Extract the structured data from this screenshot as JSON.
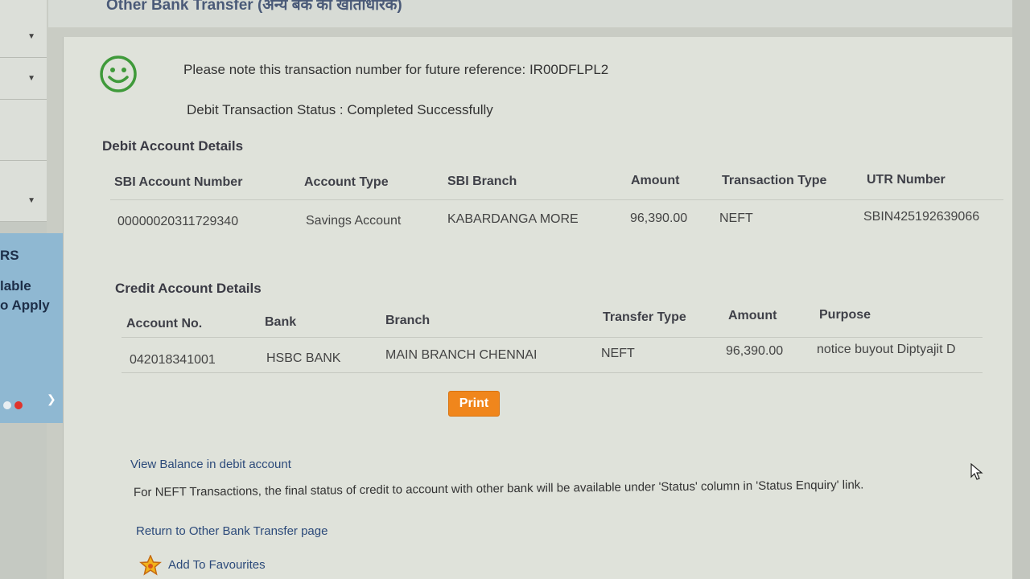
{
  "page": {
    "heading": "Other Bank Transfer (अन्य बैंक का खाताधारक)"
  },
  "sidebar": {
    "panel_line1": "RS",
    "panel_line2": "lable",
    "panel_line3": "o Apply"
  },
  "confirmation": {
    "reference_message": "Please note this transaction number for future reference: IR00DFLPL2",
    "status_message": "Debit Transaction Status : Completed Successfully"
  },
  "debit": {
    "title": "Debit Account Details",
    "headers": [
      "SBI Account Number",
      "Account Type",
      "SBI Branch",
      "Amount",
      "Transaction Type",
      "UTR Number"
    ],
    "row": [
      "00000020311729340",
      "Savings Account",
      "KABARDANGA MORE",
      "96,390.00",
      "NEFT",
      "SBIN425192639066"
    ]
  },
  "credit": {
    "title": "Credit Account Details",
    "headers": [
      "Account No.",
      "Bank",
      "Branch",
      "Transfer Type",
      "Amount",
      "Purpose"
    ],
    "row": [
      "042018341001",
      "HSBC BANK",
      "MAIN BRANCH CHENNAI",
      "NEFT",
      "96,390.00",
      "notice buyout Diptyajit D"
    ]
  },
  "actions": {
    "print_label": "Print",
    "view_balance_link": "View Balance in debit account",
    "neft_note": "For NEFT Transactions, the final status of credit to account with other bank will be available under 'Status' column in 'Status Enquiry' link.",
    "return_link": "Return to Other Bank Transfer page",
    "favourites_link": "Add To Favourites"
  },
  "icons": {
    "smiley": "smiley-face-icon",
    "star": "star-icon",
    "cursor": "mouse-pointer-icon",
    "chevron": "chevron-down-icon"
  },
  "colors": {
    "success_green": "#3f9a3a",
    "print_orange": "#f0861c",
    "link_blue": "#2c4a7a",
    "panel_blue": "#8fb8d2"
  }
}
